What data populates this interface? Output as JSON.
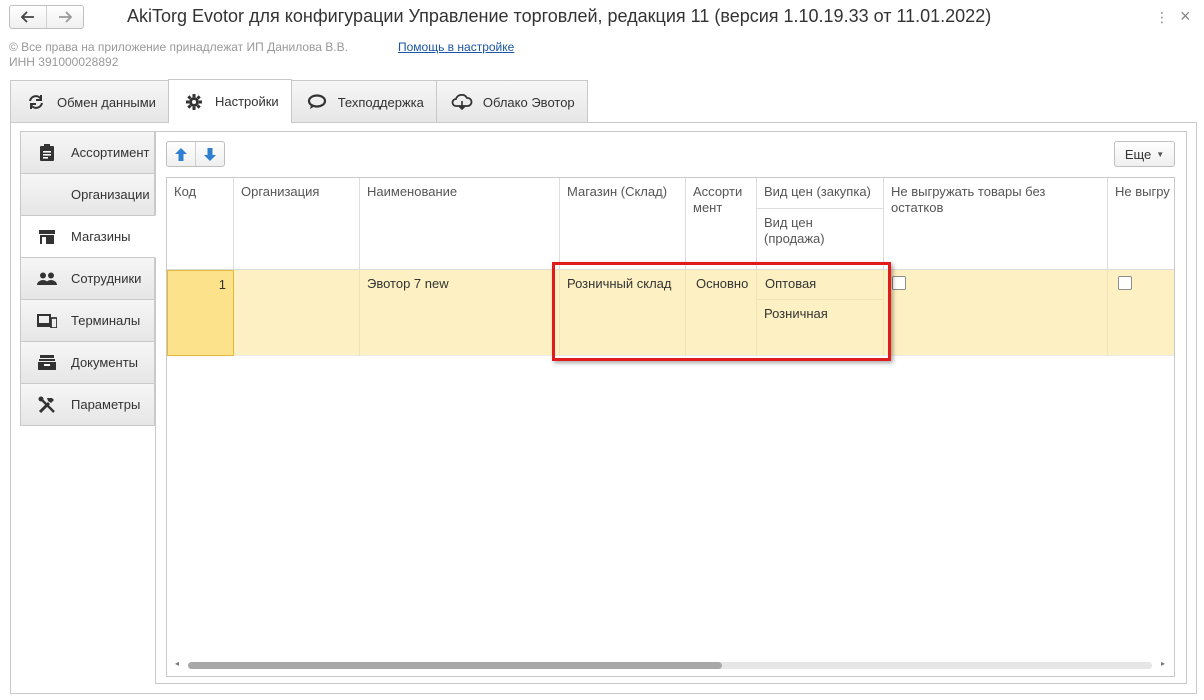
{
  "window": {
    "title": "AkiTorg Evotor для конфигурации Управление торговлей, редакция 11 (версия 1.10.19.33 от 11.01.2022)",
    "back_icon": "arrow-left-icon",
    "forward_icon": "arrow-right-icon",
    "kebab_glyph": "⋮",
    "close_glyph": "×"
  },
  "info": {
    "copyright": "© Все права на приложение принадлежат ИП Данилова В.В.",
    "help_link": "Помощь в настройке",
    "inn": "ИНН 391000028892"
  },
  "tabs": [
    {
      "label": "Обмен данными",
      "icon": "sync-icon",
      "active": false
    },
    {
      "label": "Настройки",
      "icon": "gear-icon",
      "active": true
    },
    {
      "label": "Техподдержка",
      "icon": "chat-icon",
      "active": false
    },
    {
      "label": "Облако Эвотор",
      "icon": "cloud-icon",
      "active": false
    }
  ],
  "side_menu": [
    {
      "label": "Ассортимент",
      "icon": "clipboard-icon",
      "active": false
    },
    {
      "label": "Организации",
      "icon": "",
      "active": false
    },
    {
      "label": "Магазины",
      "icon": "store-icon",
      "active": true
    },
    {
      "label": "Сотрудники",
      "icon": "people-icon",
      "active": false
    },
    {
      "label": "Терминалы",
      "icon": "devices-icon",
      "active": false
    },
    {
      "label": "Документы",
      "icon": "inbox-icon",
      "active": false
    },
    {
      "label": "Параметры",
      "icon": "tools-icon",
      "active": false
    }
  ],
  "toolbar": {
    "more_label": "Еще",
    "more_caret": "▼"
  },
  "grid": {
    "headers": {
      "code": "Код",
      "org": "Организация",
      "name": "Наименование",
      "store": "Магазин (Склад)",
      "assort": "Ассорти мент",
      "price_buy": "Вид цен (закупка)",
      "price_sell": "Вид цен (продажа)",
      "no_export": "Не выгружать товары без остатков",
      "no_export2": "Не выгру"
    },
    "rows": [
      {
        "code": "1",
        "org": "",
        "name": "Эвотор 7 new",
        "store": "Розничный склад",
        "assort": "Основно",
        "price_buy": "Оптовая",
        "price_sell": "Розничная",
        "no_export": false,
        "no_export2": false
      }
    ]
  },
  "colors": {
    "accent_link": "#1a55a6",
    "row_selected": "#fdf1c3",
    "cell_selected": "#fce28a",
    "highlight_border": "#e11b1b",
    "arrow_blue": "#2f7fd1"
  },
  "scrollbar": {
    "left_glyph": "◂",
    "right_glyph": "▸"
  }
}
